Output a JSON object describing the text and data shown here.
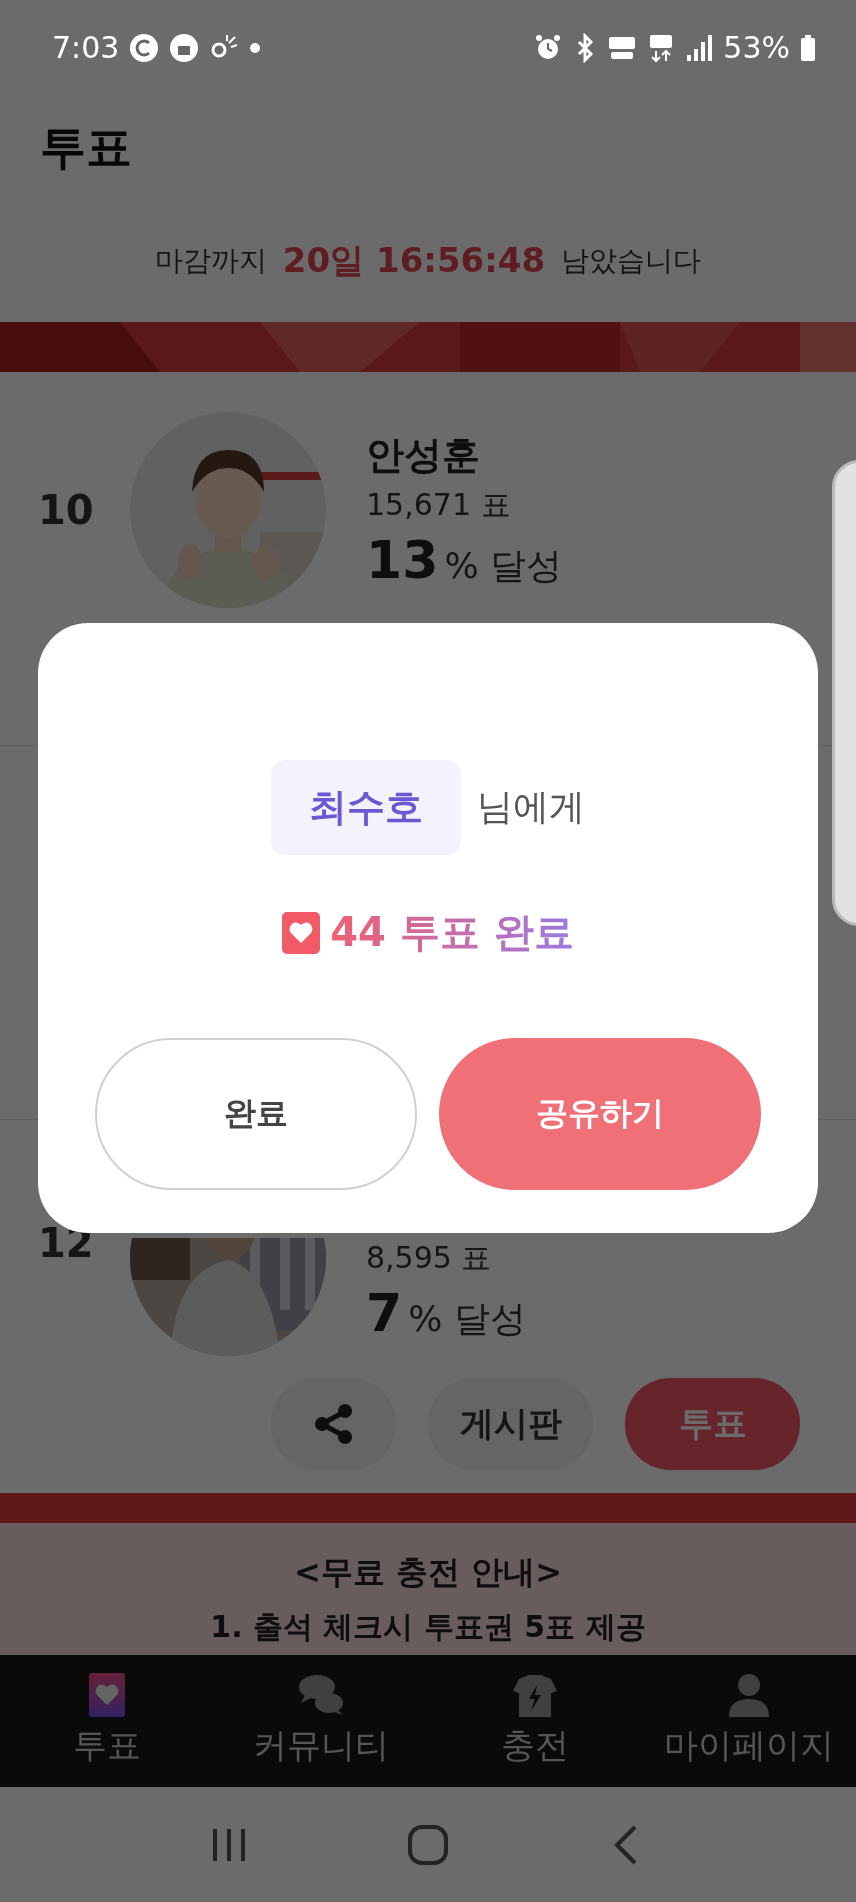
{
  "status_bar": {
    "time": "7:03",
    "battery": "53%"
  },
  "header": {
    "title": "투표"
  },
  "deadline": {
    "prefix": "마감까지",
    "remaining": "20일 16:56:48",
    "suffix": "남았습니다"
  },
  "candidates": [
    {
      "rank": "10",
      "name": "안성훈",
      "votes": "15,671 표",
      "percent": "13",
      "percent_label": "% 달성"
    },
    {
      "rank": "12",
      "votes": "8,595 표",
      "percent": "7",
      "percent_label": "% 달성",
      "actions": [
        "게시판",
        "투표"
      ]
    }
  ],
  "notice": {
    "title": "<무료 충전 안내>",
    "lines": [
      "1. 출석 체크시 투표권 5표 제공"
    ]
  },
  "dialog": {
    "recipient": "최수호",
    "recipient_suffix": "님에게",
    "result": "44 투표 완료",
    "buttons": [
      {
        "label": "완료",
        "kind": "secondary"
      },
      {
        "label": "공유하기",
        "kind": "primary"
      }
    ]
  },
  "bottom_nav": [
    {
      "label": "투표",
      "selected": true
    },
    {
      "label": "커뮤니티",
      "selected": false
    },
    {
      "label": "충전",
      "selected": false
    },
    {
      "label": "마이페이지",
      "selected": false
    }
  ]
}
